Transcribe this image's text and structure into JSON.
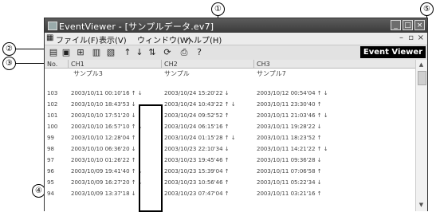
{
  "callouts": [
    "①",
    "②",
    "③",
    "④",
    "⑤"
  ],
  "window": {
    "title": "EventViewer - [サンプルデータ.ev7]"
  },
  "menu": [
    "ファイル(F)",
    "表示(V)",
    "ウィンドウ(W)",
    "ヘルプ(H)"
  ],
  "toolbar": {
    "brand": "Event Viewer",
    "icons": [
      "open-icon",
      "save-icon",
      "network-icon",
      "chart-bars-icon",
      "chart-bars2-icon",
      "arrow-up-icon",
      "arrow-down-icon",
      "arrow-updown-icon",
      "refresh-icon",
      "print-icon",
      "help-icon"
    ]
  },
  "table": {
    "headers": [
      "No.",
      "CH1",
      "CH2",
      "CH3"
    ],
    "names": [
      "サンプル3",
      "サンプル",
      "サンプル7"
    ],
    "rows": [
      {
        "no": "103",
        "ch1": "2003/10/11 00:10'16 ↑ ↓",
        "ch2": "2003/10/24 15:20'22 ↓",
        "ch3": "2003/10/12 00:54'04 ↑ ↓"
      },
      {
        "no": "102",
        "ch1": "2003/10/10 18:43'53 ↓",
        "ch2": "2003/10/24 10:43'22 ↑ ↓",
        "ch3": "2003/10/11 23:30'40 ↑"
      },
      {
        "no": "101",
        "ch1": "2003/10/10 17:51'20 ↓",
        "ch2": "2003/10/24 09:52'52 ↑",
        "ch3": "2003/10/11 21:03'46 ↑ ↓"
      },
      {
        "no": "100",
        "ch1": "2003/10/10 16:57'10 ↑ ↓",
        "ch2": "2003/10/24 06:15'16 ↑",
        "ch3": "2003/10/11 19:28'22 ↓"
      },
      {
        "no": "99",
        "ch1": "2003/10/10 12:28'04 ↑",
        "ch2": "2003/10/24 01:15'28 ↑ ↓",
        "ch3": "2003/10/11 18:23'52 ↑"
      },
      {
        "no": "98",
        "ch1": "2003/10/10 06:36'20 ↓",
        "ch2": "2003/10/23 22:10'34 ↓",
        "ch3": "2003/10/11 14:21'22 ↑ ↓"
      },
      {
        "no": "97",
        "ch1": "2003/10/10 01:26'22 ↑",
        "ch2": "2003/10/23 19:45'46 ↑",
        "ch3": "2003/10/11 09:36'28 ↓"
      },
      {
        "no": "96",
        "ch1": "2003/10/09 19:41'40 ↑ ↓",
        "ch2": "2003/10/23 15:39'04 ↑",
        "ch3": "2003/10/11 07:06'58 ↑"
      },
      {
        "no": "95",
        "ch1": "2003/10/09 16:27'20 ↑ ↓",
        "ch2": "2003/10/23 10:56'46 ↑",
        "ch3": "2003/10/11 05:22'34 ↓"
      },
      {
        "no": "94",
        "ch1": "2003/10/09 13:37'18 ↓",
        "ch2": "2003/10/23 07:47'04 ↑",
        "ch3": "2003/10/11 03:21'16 ↑"
      }
    ]
  }
}
